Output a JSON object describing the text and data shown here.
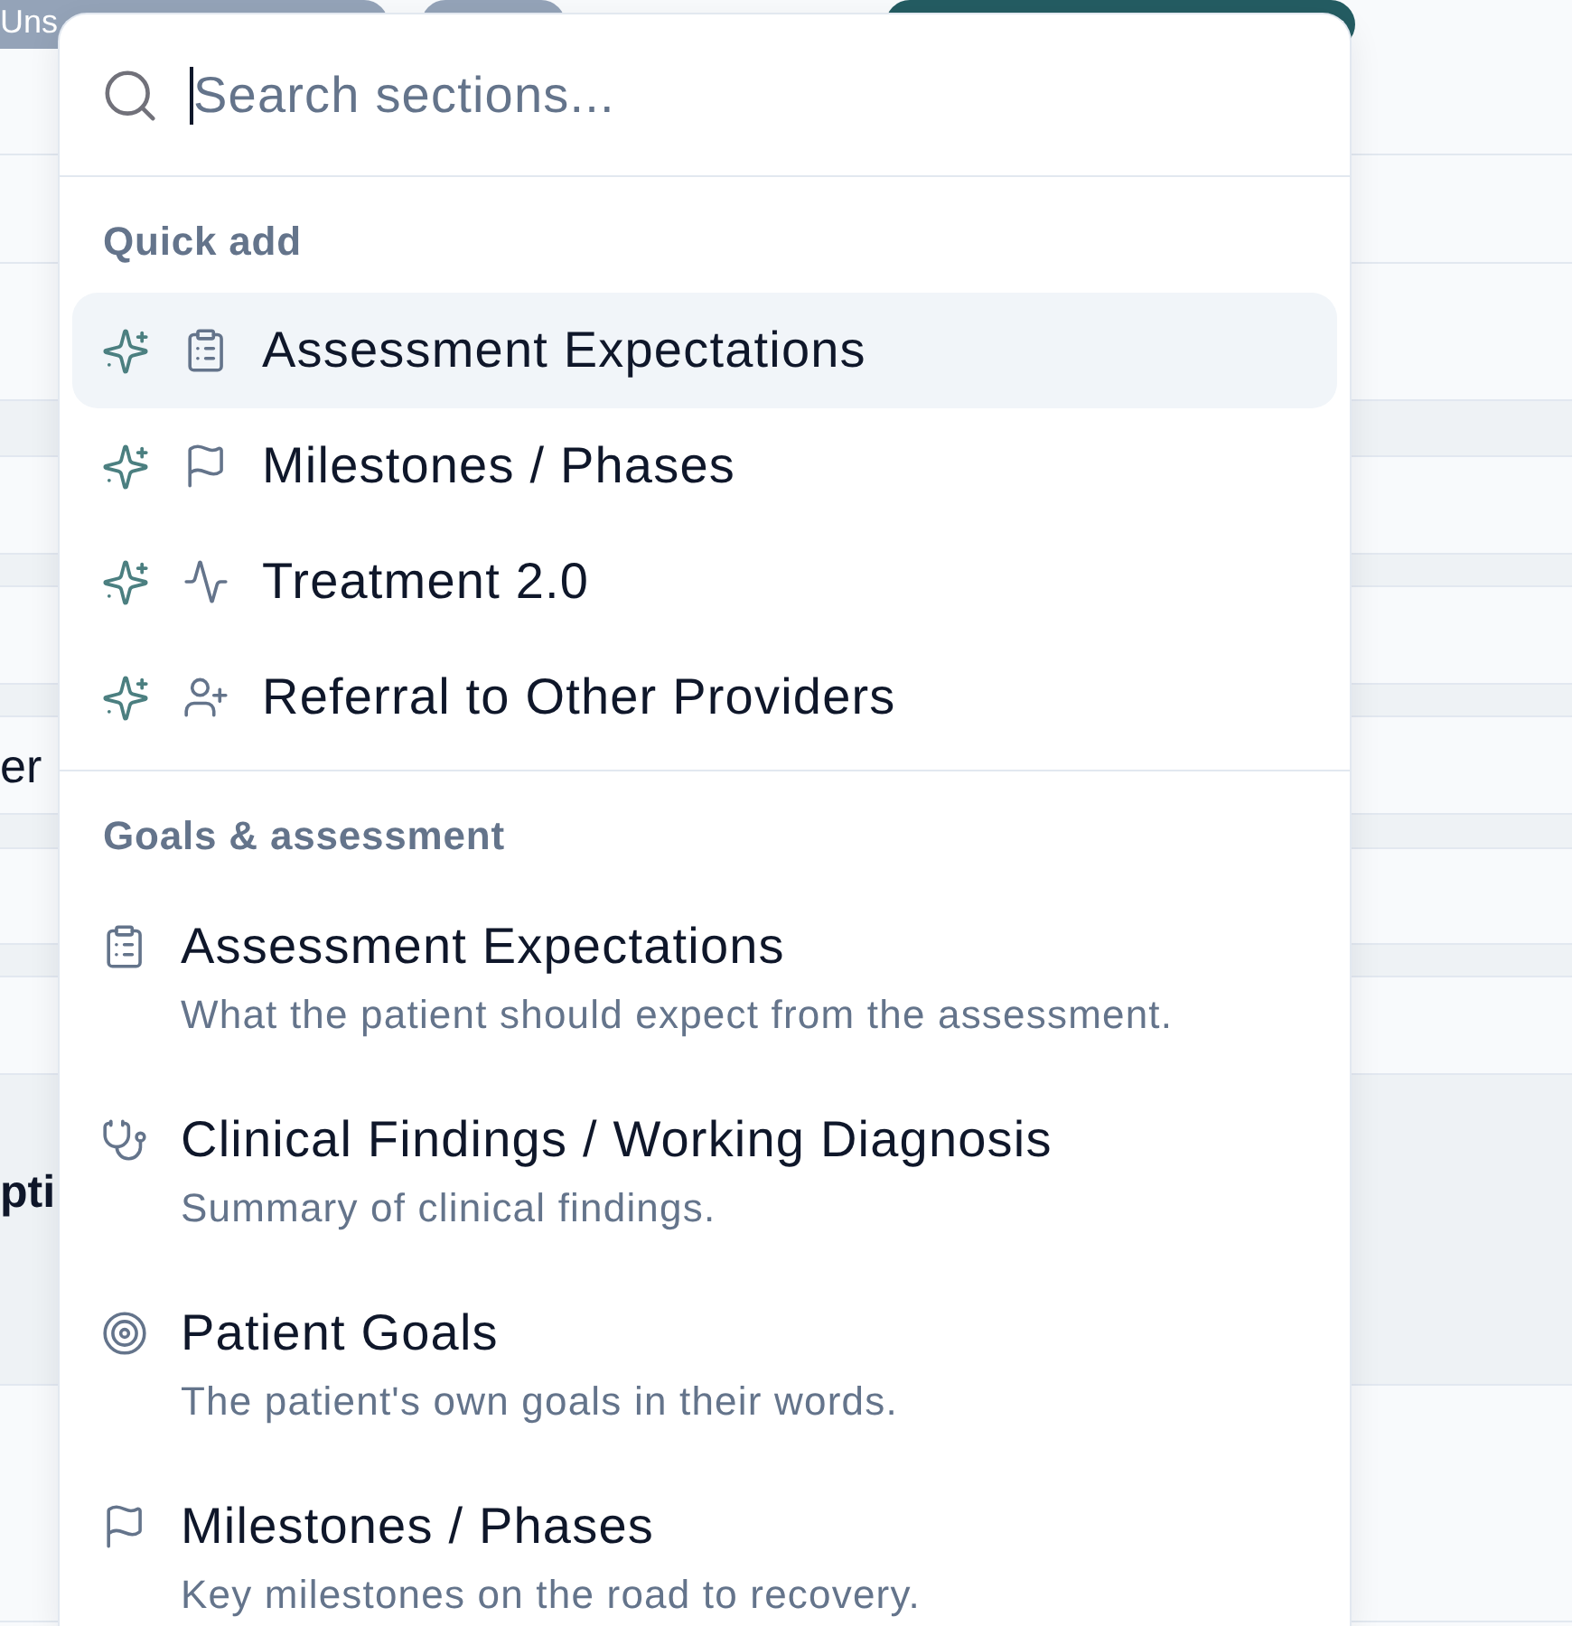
{
  "background": {
    "pill_label": "Uns",
    "texts": [
      {
        "text": "er"
      },
      {
        "text": "pti"
      }
    ]
  },
  "popover": {
    "search": {
      "placeholder": "Search sections...",
      "focused": true
    },
    "sections": [
      {
        "title": "Quick add",
        "kind": "quick",
        "items": [
          {
            "label": "Assessment Expectations",
            "selected": true
          },
          {
            "label": "Milestones / Phases",
            "selected": false
          },
          {
            "label": "Treatment 2.0",
            "selected": false
          },
          {
            "label": "Referral to Other Providers",
            "selected": false
          }
        ]
      },
      {
        "title": "Goals & assessment",
        "kind": "detailed",
        "items": [
          {
            "title": "Assessment Expectations",
            "description": "What the patient should expect from the assessment.",
            "selected": false
          },
          {
            "title": "Clinical Findings / Working Diagnosis",
            "description": "Summary of clinical findings.",
            "selected": false
          },
          {
            "title": "Patient Goals",
            "description": "The patient's own goals in their words.",
            "selected": false
          },
          {
            "title": "Milestones / Phases",
            "description": "Key milestones on the road to recovery.",
            "selected": false
          }
        ]
      }
    ]
  }
}
